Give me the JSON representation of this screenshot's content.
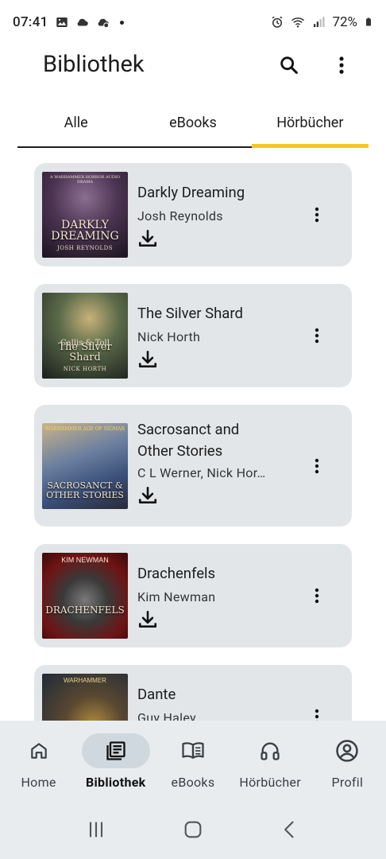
{
  "status": {
    "time": "07:41",
    "battery": "72%"
  },
  "app": {
    "title": "Bibliothek"
  },
  "tabs": [
    {
      "label": "Alle",
      "active": false
    },
    {
      "label": "eBooks",
      "active": false
    },
    {
      "label": "Hörbücher",
      "active": true
    }
  ],
  "books": [
    {
      "title": "Darkly Dreaming",
      "author": "Josh Reynolds",
      "cover_title": "DARKLY DREAMING",
      "cover_author": "JOSH REYNOLDS",
      "cover_top": "A WARHAMMER HORROR AUDIO DRAMA"
    },
    {
      "title": "The Silver Shard",
      "author": "Nick Horth",
      "cover_title": "The Silver Shard",
      "cover_author": "NICK HORTH",
      "cover_top": "Callis & Toll"
    },
    {
      "title": "Sacrosanct and Other Stories",
      "author": "C L Werner, Nick Hor…",
      "cover_title": "SACROSANCT & OTHER STORIES",
      "cover_author": "",
      "cover_top": "WARHAMMER AGE OF SIGMAR"
    },
    {
      "title": "Drachenfels",
      "author": "Kim Newman",
      "cover_title": "DRACHENFELS",
      "cover_author": "",
      "cover_top": "KIM NEWMAN"
    },
    {
      "title": "Dante",
      "author": "Guy Haley",
      "cover_title": "",
      "cover_author": "",
      "cover_top": "WARHAMMER"
    }
  ],
  "bottom_nav": [
    {
      "label": "Home",
      "icon": "home-icon",
      "active": false
    },
    {
      "label": "Bibliothek",
      "icon": "library-icon",
      "active": true
    },
    {
      "label": "eBooks",
      "icon": "book-open-icon",
      "active": false
    },
    {
      "label": "Hörbücher",
      "icon": "headphones-icon",
      "active": false
    },
    {
      "label": "Profil",
      "icon": "profile-icon",
      "active": false
    }
  ],
  "colors": {
    "accent": "#f6c625",
    "card_bg": "#e3e6e9",
    "nav_bg": "#e9ecef",
    "nav_active_pill": "#cfd8de"
  }
}
